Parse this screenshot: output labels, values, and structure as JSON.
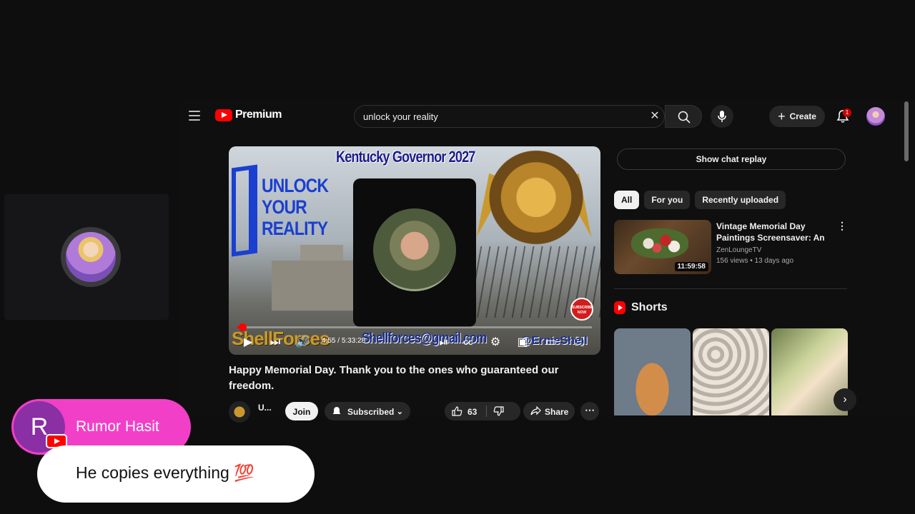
{
  "youtube": {
    "logo_text": "Premium",
    "search": {
      "value": "unlock your reality",
      "placeholder": "Search"
    },
    "create_label": "Create",
    "notification_count": "1"
  },
  "player": {
    "overlay_title": "Kentucky Governor 2027",
    "overlay_unlock": "UNLOCK YOUR REALITY",
    "overlay_brand": "ShellForces",
    "overlay_email": "Shellforces@gmail.com",
    "overlay_handle": "@ErnieShell",
    "subscribe_badge": "SUBSCRIBE NOW",
    "current_time": "4:55",
    "duration": "5:33:28",
    "progress_fraction": 0.015,
    "cc_label": "CC"
  },
  "video": {
    "title": "Happy Memorial Day. Thank you to the ones who guaranteed our freedom.",
    "owner_name": "U...",
    "join_label": "Join",
    "subscribed_label": "Subscribed",
    "like_count": "63",
    "share_label": "Share"
  },
  "sidebar": {
    "chat_replay_label": "Show chat replay",
    "chips": [
      "All",
      "For you",
      "Recently uploaded"
    ],
    "recommendation": {
      "title": "Vintage Memorial Day Paintings Screensaver: An Artful Tribute ...",
      "channel": "ZenLoungeTV",
      "meta": "156 views • 13 days ago",
      "duration": "11:59:58"
    },
    "shorts_label": "Shorts"
  },
  "stream_chat": {
    "avatar_letter": "R",
    "author": "Rumor Hasit",
    "message": "He copies everything 💯"
  },
  "colors": {
    "accent": "#ff0000",
    "chat_pill": "#f23fc8",
    "chat_avatar": "#8a2fa4"
  }
}
